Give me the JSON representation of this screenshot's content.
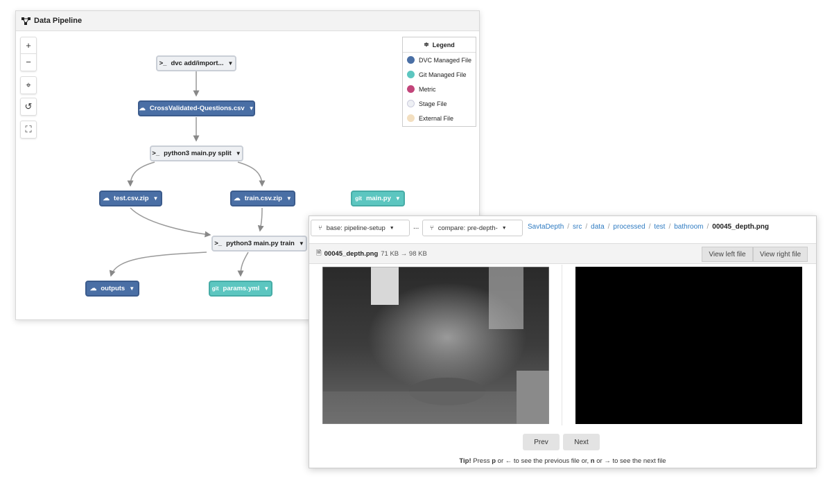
{
  "pipeline": {
    "title": "Data Pipeline",
    "controls": {
      "zoom_in": "+",
      "zoom_out": "−"
    },
    "nodes": [
      {
        "label": "dvc add/import...",
        "kind": "stage",
        "icon": "terminal-icon"
      },
      {
        "label": "CrossValidated-Questions.csv",
        "kind": "dvc",
        "icon": "database-icon"
      },
      {
        "label": "python3 main.py split",
        "kind": "stage",
        "icon": "terminal-icon"
      },
      {
        "label": "test.csv.zip",
        "kind": "dvc",
        "icon": "database-icon"
      },
      {
        "label": "train.csv.zip",
        "kind": "dvc",
        "icon": "database-icon"
      },
      {
        "label": "main.py",
        "kind": "git",
        "icon": "git-icon"
      },
      {
        "label": "python3 main.py train",
        "kind": "stage",
        "icon": "terminal-icon"
      },
      {
        "label": "outputs",
        "kind": "dvc",
        "icon": "database-icon"
      },
      {
        "label": "params.yml",
        "kind": "git",
        "icon": "git-icon"
      }
    ],
    "legend": {
      "title": "Legend",
      "items": [
        {
          "label": "DVC Managed File",
          "color": "#4a6fa5"
        },
        {
          "label": "Git Managed File",
          "color": "#5cc6c0"
        },
        {
          "label": "Metric",
          "color": "#c2457a"
        },
        {
          "label": "Stage File",
          "color": "#eef0f4"
        },
        {
          "label": "External File",
          "color": "#f3dfc0"
        }
      ]
    }
  },
  "diff": {
    "base": "base: pipeline-setup",
    "ellipsis": "...",
    "compare": "compare: pre-depth-",
    "breadcrumbs": [
      "SavtaDepth",
      "src",
      "data",
      "processed",
      "test",
      "bathroom"
    ],
    "sep": "/",
    "current_file": "00045_depth.png",
    "file_name": "00045_depth.png",
    "size_change": "71 KB → 98 KB",
    "view_left": "View left file",
    "view_right": "View right file",
    "prev": "Prev",
    "next": "Next",
    "tip": {
      "bold": "Tip!",
      "t1": " Press ",
      "p": "p",
      "t2": " or ← to see the previous file or, ",
      "n": "n",
      "t3": " or → to see the next file"
    }
  }
}
